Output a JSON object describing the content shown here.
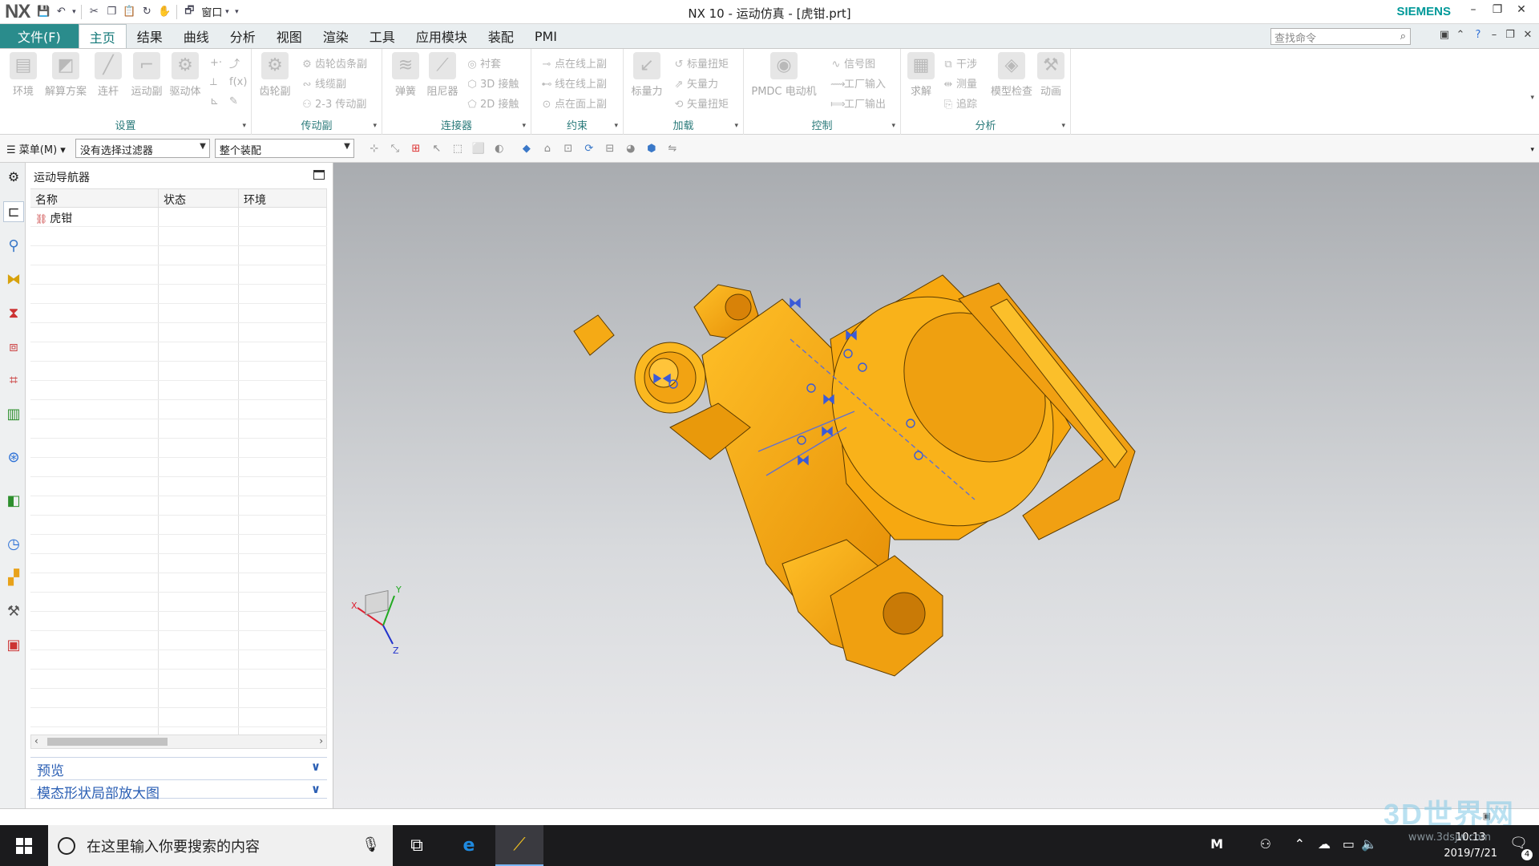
{
  "titlebar": {
    "logo": "NX",
    "window_menu": "窗口",
    "title": "NX 10 - 运动仿真 - [虎钳.prt]",
    "brand": "SIEMENS",
    "min": "–",
    "restore": "❐",
    "close": "✕"
  },
  "menu": {
    "file": "文件(F)",
    "tabs": [
      "主页",
      "结果",
      "曲线",
      "分析",
      "视图",
      "渲染",
      "工具",
      "应用模块",
      "装配",
      "PMI"
    ],
    "active_tab": "主页",
    "search_placeholder": "查找命令"
  },
  "ribbon": {
    "groups": {
      "setup": {
        "label": "设置",
        "big": [
          "环境",
          "解算方案",
          "连杆",
          "运动副",
          "驱动体"
        ]
      },
      "transmission": {
        "label": "传动副",
        "big": [
          "齿轮副"
        ],
        "small": [
          "齿轮齿条副",
          "线缆副",
          "2-3 传动副"
        ]
      },
      "connector": {
        "label": "连接器",
        "big": [
          "弹簧",
          "阻尼器"
        ],
        "small": [
          "衬套",
          "3D 接触",
          "2D 接触"
        ]
      },
      "constraint": {
        "label": "约束",
        "small": [
          "点在线上副",
          "线在线上副",
          "点在面上副"
        ]
      },
      "load": {
        "label": "加载",
        "big": [
          "标量力"
        ],
        "small": [
          "标量扭矩",
          "矢量力",
          "矢量扭矩"
        ]
      },
      "control": {
        "label": "控制",
        "big": [
          "PMDC 电动机"
        ],
        "small": [
          "信号图",
          "工厂输入",
          "工厂输出"
        ]
      },
      "analysis": {
        "label": "分析",
        "big": [
          "求解",
          "模型检查",
          "动画"
        ],
        "small": [
          "干涉",
          "测量",
          "追踪"
        ]
      }
    }
  },
  "toolbar": {
    "menu_button": "菜单(M)",
    "filter": "没有选择过滤器",
    "assembly": "整个装配"
  },
  "navigator": {
    "title": "运动导航器",
    "columns": [
      "名称",
      "状态",
      "环境"
    ],
    "rows": [
      {
        "name": "虎钳",
        "status": "",
        "env": ""
      }
    ],
    "panels": [
      "预览",
      "模态形状局部放大图"
    ]
  },
  "viewport": {
    "triad_x": "X",
    "triad_y": "Y",
    "triad_z": "Z"
  },
  "taskbar": {
    "search_placeholder": "在这里输入你要搜索的内容",
    "time": "10:13",
    "date": "2019/7/21",
    "notification_count": "4",
    "ime": "M"
  },
  "watermark": {
    "brand": "3D世界网",
    "url": "www.3dsjw.com"
  },
  "colors": {
    "accent": "#2a8c8c",
    "model": "#f5a50f",
    "siemens": "#009999",
    "panel_link": "#2b5fb4"
  }
}
